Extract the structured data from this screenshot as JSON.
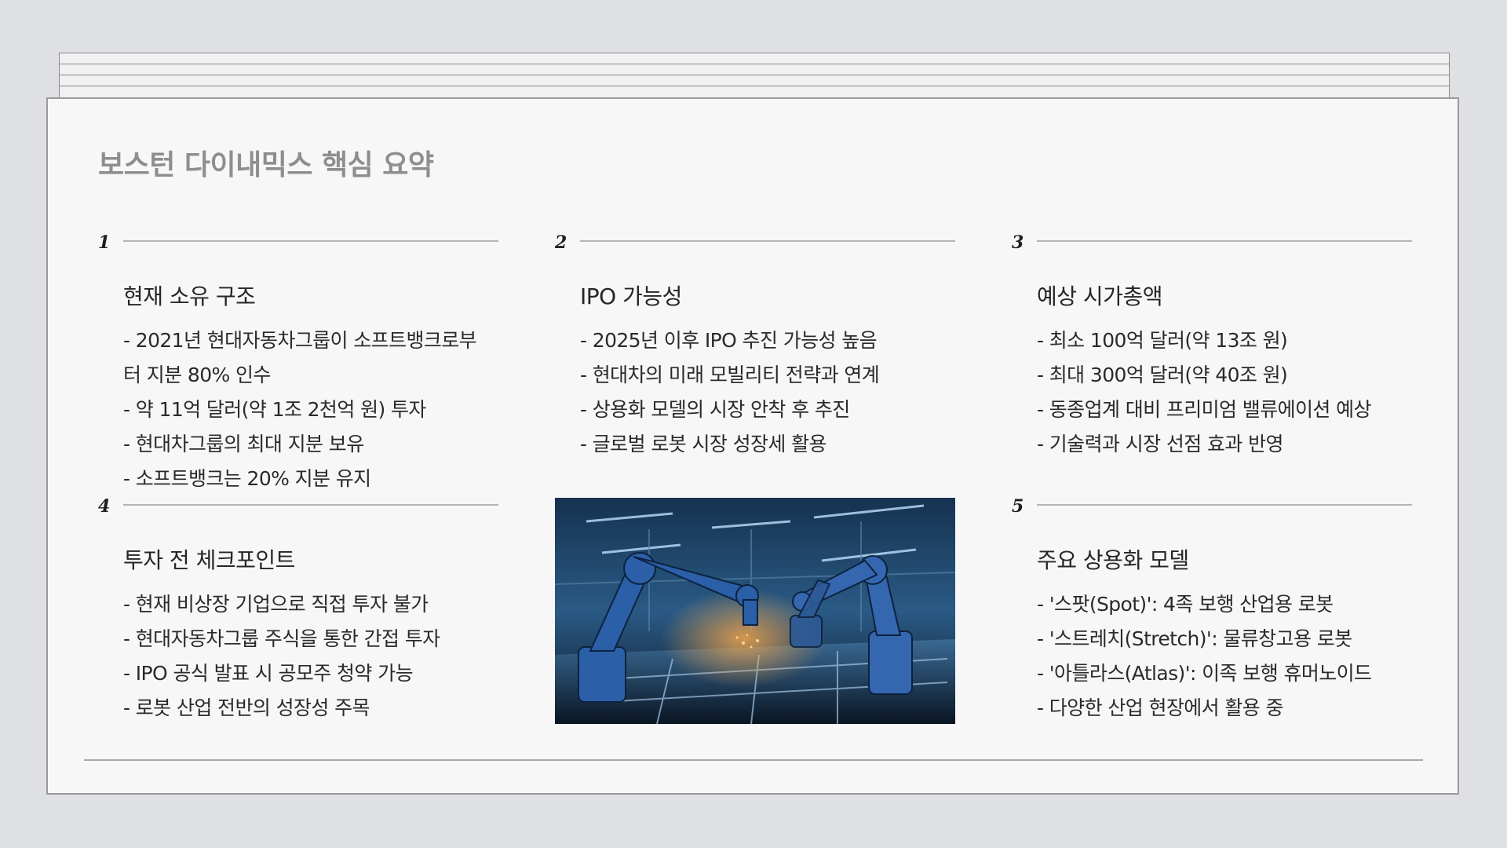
{
  "slide": {
    "title": "보스턴 다이내믹스 핵심 요약"
  },
  "sections": [
    {
      "number": "1",
      "heading": "현재 소유 구조",
      "items": [
        "- 2021년 현대자동차그룹이 소프트뱅크로부터 지분 80% 인수",
        "- 약 11억 달러(약 1조 2천억 원) 투자",
        "- 현대차그룹의 최대 지분 보유",
        "- 소프트뱅크는 20% 지분 유지"
      ]
    },
    {
      "number": "2",
      "heading": "IPO 가능성",
      "items": [
        "- 2025년 이후 IPO 추진 가능성 높음",
        "- 현대차의 미래 모빌리티 전략과 연계",
        "- 상용화 모델의 시장 안착 후 추진",
        "- 글로벌 로봇 시장 성장세 활용"
      ]
    },
    {
      "number": "3",
      "heading": "예상 시가총액",
      "items": [
        "- 최소 100억 달러(약 13조 원)",
        "- 최대 300억 달러(약 40조 원)",
        "- 동종업계 대비 프리미엄 밸류에이션 예상",
        "- 기술력과 시장 선점 효과 반영"
      ]
    },
    {
      "number": "4",
      "heading": "투자 전 체크포인트",
      "items": [
        "- 현재 비상장 기업으로 직접 투자 불가",
        "- 현대자동차그룹 주식을 통한 간접 투자",
        "- IPO 공식 발표 시 공모주 청약 가능",
        "- 로봇 산업 전반의 성장성 주목"
      ]
    },
    {
      "number": "5",
      "heading": "주요 상용화 모델",
      "items": [
        "- '스팟(Spot)': 4족 보행 산업용 로봇",
        "- '스트레치(Stretch)': 물류창고용 로봇",
        "- '아틀라스(Atlas)': 이족 보행 휴머노이드",
        "- 다양한 산업 현장에서 활용 중"
      ]
    }
  ],
  "image": {
    "subject": "robotic-arms-factory-photo"
  }
}
